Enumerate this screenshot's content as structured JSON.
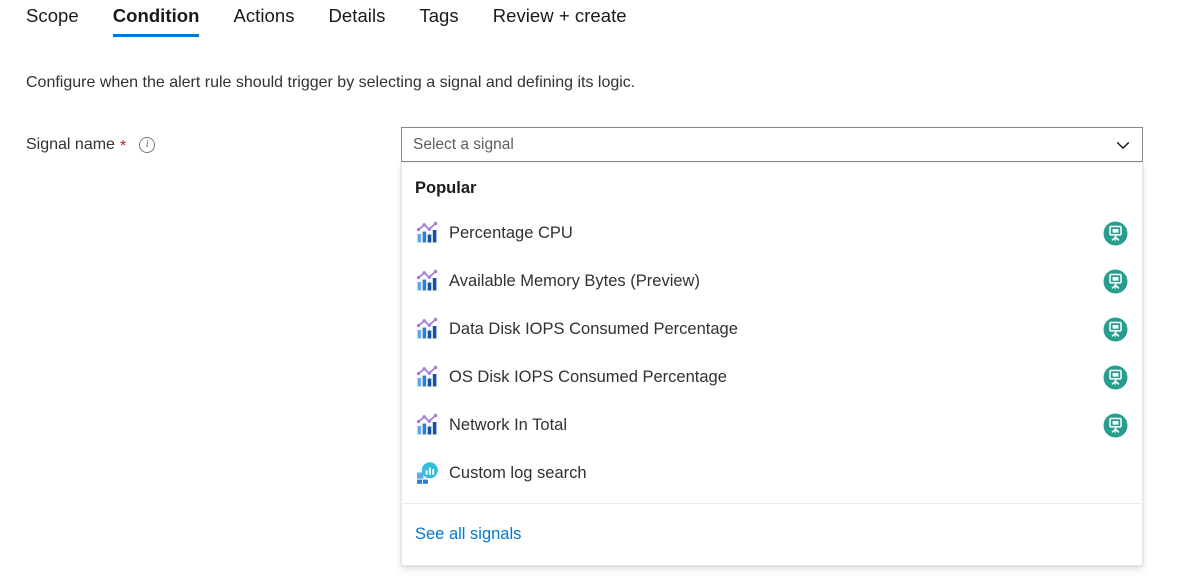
{
  "tabs": [
    {
      "label": "Scope",
      "selected": false
    },
    {
      "label": "Condition",
      "selected": true
    },
    {
      "label": "Actions",
      "selected": false
    },
    {
      "label": "Details",
      "selected": false
    },
    {
      "label": "Tags",
      "selected": false
    },
    {
      "label": "Review + create",
      "selected": false
    }
  ],
  "description": "Configure when the alert rule should trigger by selecting a signal and defining its logic.",
  "field": {
    "label": "Signal name",
    "required_marker": "*",
    "info_icon": "info-icon",
    "info_glyph": "i"
  },
  "combobox": {
    "placeholder": "Select a signal",
    "value": "",
    "chevron_icon": "chevron-down-icon"
  },
  "dropdown": {
    "group_header": "Popular",
    "options": [
      {
        "label": "Percentage CPU",
        "icon": "metric-chart-icon",
        "badge": "virtual-machine-badge-icon",
        "has_badge": true
      },
      {
        "label": "Available Memory Bytes (Preview)",
        "icon": "metric-chart-icon",
        "badge": "virtual-machine-badge-icon",
        "has_badge": true
      },
      {
        "label": "Data Disk IOPS Consumed Percentage",
        "icon": "metric-chart-icon",
        "badge": "virtual-machine-badge-icon",
        "has_badge": true
      },
      {
        "label": "OS Disk IOPS Consumed Percentage",
        "icon": "metric-chart-icon",
        "badge": "virtual-machine-badge-icon",
        "has_badge": true
      },
      {
        "label": "Network In Total",
        "icon": "metric-chart-icon",
        "badge": "virtual-machine-badge-icon",
        "has_badge": true
      },
      {
        "label": "Custom log search",
        "icon": "log-analytics-icon",
        "badge": "",
        "has_badge": false
      }
    ],
    "footer_link": "See all signals"
  },
  "colors": {
    "accent_blue": "#0078d4",
    "required_red": "#a4262c",
    "badge_teal": "#2a9d8f",
    "icon_purple": "#a47cd8",
    "icon_blue_light": "#5ea9e8",
    "icon_blue_dark": "#13559e",
    "text_primary": "#323130",
    "link_blue": "#0078d4"
  }
}
